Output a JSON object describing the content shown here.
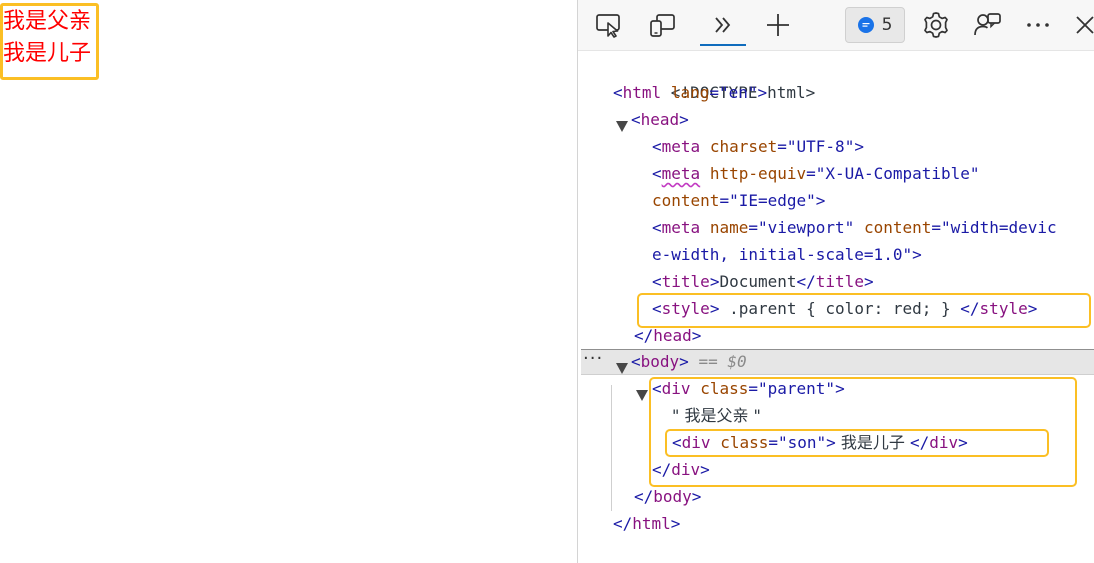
{
  "page": {
    "parent_text": "我是父亲",
    "son_text": "我是儿子",
    "colors": {
      "text": "#ff0000",
      "highlight": "#fbbf24"
    }
  },
  "toolbar": {
    "buttons": [
      {
        "name": "inspect-element-icon"
      },
      {
        "name": "device-emulation-icon"
      },
      {
        "name": "more-tabs-icon"
      },
      {
        "name": "new-tab-icon"
      }
    ],
    "issues_count": "5",
    "right_icons": [
      "settings-icon",
      "feedback-icon",
      "more-options-icon",
      "close-icon"
    ]
  },
  "dom": {
    "doctype": "<!DOCTYPE html>",
    "html_tag": "html",
    "html_attr": "lang",
    "html_val": "\"en\"",
    "head_tag": "head",
    "meta_tag": "meta",
    "charset_attr": "charset",
    "charset_val": "\"UTF-8\"",
    "http_equiv_attr": "http-equiv",
    "http_equiv_val": "\"X-UA-Compatible\"",
    "content_attr": "content",
    "content_val_1": "\"IE=edge\"",
    "name_attr": "name",
    "name_val": "\"viewport\"",
    "content_val_2a": "\"width=devic",
    "content_val_2b": "e-width, initial-scale=1.0\"",
    "title_tag": "title",
    "title_text": "Document",
    "style_tag": "style",
    "style_text": " .parent { color: red; } ",
    "body_tag": "body",
    "body_marker": "== $0",
    "div_tag": "div",
    "class_attr": "class",
    "parent_val": "\"parent\"",
    "text_node": "\" 我是父亲 \"",
    "son_val": "\"son\"",
    "son_text": " 我是儿子 ",
    "ellipsis": "···"
  }
}
